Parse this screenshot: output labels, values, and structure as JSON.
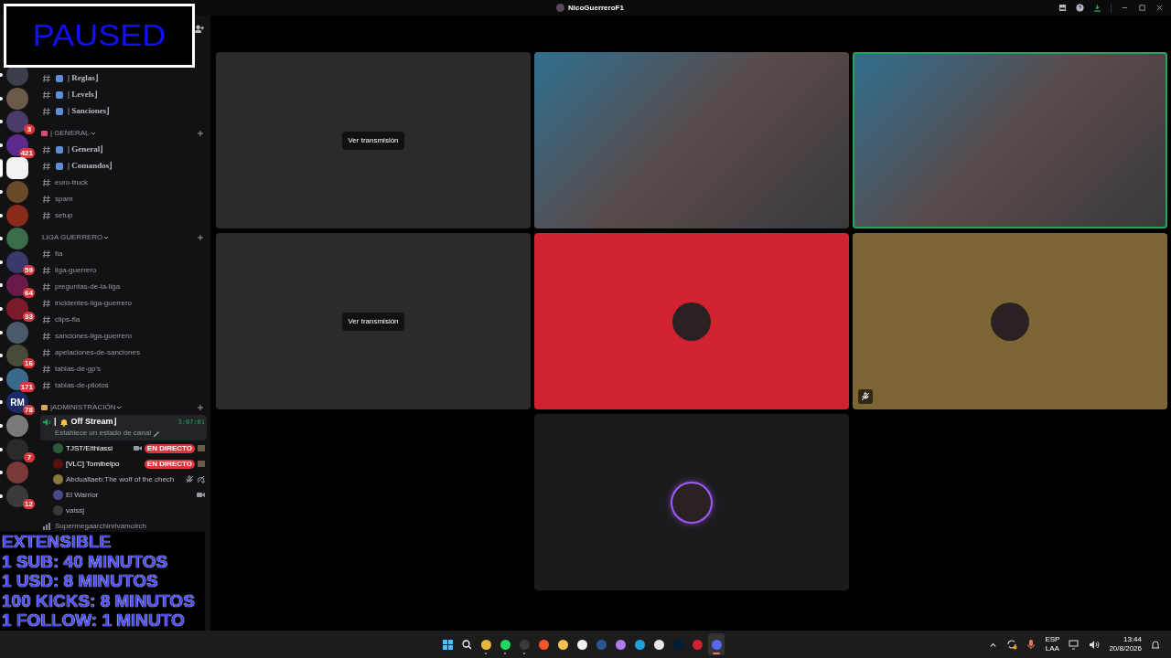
{
  "window": {
    "title": "NicoGuerreroF1"
  },
  "paused_overlay": {
    "text": "PAUSED"
  },
  "servers": [
    {
      "unread": true,
      "selected": false
    },
    {
      "unread": true,
      "selected": false
    },
    {
      "unread": true,
      "selected": false,
      "badge": "3"
    },
    {
      "unread": true,
      "selected": false,
      "badge": "421"
    },
    {
      "selected": true
    },
    {
      "unread": true,
      "selected": false
    },
    {
      "unread": true,
      "selected": false
    },
    {
      "unread": true,
      "selected": false
    },
    {
      "unread": true,
      "selected": false,
      "badge": "59"
    },
    {
      "unread": true,
      "selected": false,
      "badge": "64"
    },
    {
      "unread": true,
      "selected": false,
      "badge": "33"
    },
    {
      "unread": true,
      "selected": false
    },
    {
      "unread": true,
      "selected": false,
      "badge": "16"
    },
    {
      "unread": true,
      "selected": false,
      "badge": "171"
    },
    {
      "unread": true,
      "selected": false,
      "badge": "78",
      "label": "RM"
    },
    {
      "unread": true,
      "selected": false
    },
    {
      "unread": true,
      "selected": false,
      "badge": "7"
    },
    {
      "unread": true,
      "selected": false
    },
    {
      "unread": true,
      "selected": false,
      "badge": "12"
    }
  ],
  "categories": [
    {
      "channels": [
        {
          "kind": "decorated",
          "name": "| Reglas⌋"
        },
        {
          "kind": "decorated",
          "name": "| Levels⌋"
        },
        {
          "kind": "decorated",
          "name": "| Sanciones⌋"
        }
      ]
    },
    {
      "name": "| GENERAL",
      "channels": [
        {
          "kind": "decorated",
          "name": "| General⌋"
        },
        {
          "kind": "decorated",
          "name": "| Comandos⌋"
        },
        {
          "kind": "plain",
          "name": "euro-truck"
        },
        {
          "kind": "plain",
          "name": "spam"
        },
        {
          "kind": "plain",
          "name": "setup"
        }
      ]
    },
    {
      "name": "LIGA GUERRERO",
      "channels": [
        {
          "kind": "plain",
          "name": "fia"
        },
        {
          "kind": "plain",
          "name": "liga-guerrero"
        },
        {
          "kind": "plain",
          "name": "preguntas-de-la-liga"
        },
        {
          "kind": "plain",
          "name": "incidentes-liga-guerrero"
        },
        {
          "kind": "plain",
          "name": "clips-fia"
        },
        {
          "kind": "plain",
          "name": "sanciones-liga-guerrero"
        },
        {
          "kind": "plain",
          "name": "apelaciones-de-sanciones"
        },
        {
          "kind": "plain",
          "name": "tablas-de-gp's"
        },
        {
          "kind": "plain",
          "name": "tablas-de-pilotos"
        }
      ]
    },
    {
      "name": "|ADMINISTRACIÓN"
    }
  ],
  "voice_channel": {
    "prefix": "|",
    "name": "Off Stream⌋",
    "timer": "3:07:01",
    "status_hint": "Establece un estado de canal",
    "users": [
      {
        "name": "TJST/Elthiassi",
        "camera": true,
        "muted": false,
        "badge": "EN DIRECTO"
      },
      {
        "name": "[VLC] Tomibelpo",
        "camera": false,
        "muted": false,
        "badge": "EN DIRECTO"
      },
      {
        "name": "Abduallaeb:The wolf of the chech",
        "camera": false,
        "muted": true
      },
      {
        "name": "El Warrior",
        "camera": true,
        "muted": false
      },
      {
        "name": "vaissj",
        "camera": false,
        "muted": false
      }
    ]
  },
  "next_channel": {
    "name": "Supermegaarchinrivamoirch"
  },
  "stream_overlay": {
    "lines": [
      "EXTENSIBLE",
      "1 SUB: 40 MINUTOS",
      "1 USD: 8 MINUTOS",
      "100 KICKS: 8 MINUTOS",
      "1 FOLLOW: 1 MINUTO"
    ]
  },
  "tiles": [
    {
      "kind": "stream",
      "button": "Ver transmisión",
      "speaking": false
    },
    {
      "kind": "video",
      "speaking": false
    },
    {
      "kind": "video",
      "speaking": true
    },
    {
      "kind": "stream",
      "button": "Ver transmisión",
      "speaking": false
    },
    {
      "kind": "avatar",
      "color": "#d0222f",
      "speaking": false,
      "muted": false
    },
    {
      "kind": "avatar",
      "color": "#7c6434",
      "speaking": false,
      "muted": true
    },
    {
      "kind": "avatar",
      "color": "#1b1b1d",
      "speaking": true,
      "muted": false
    }
  ],
  "taskbar": {
    "apps": [
      {
        "kind": "start",
        "running": false,
        "active": false
      },
      {
        "kind": "search",
        "running": false,
        "active": false
      },
      {
        "kind": "app",
        "color": "#e8b73a",
        "running": true,
        "active": false
      },
      {
        "kind": "app",
        "color": "#1ed760",
        "running": true,
        "active": false
      },
      {
        "kind": "app",
        "color": "#3a3a3a",
        "running": true,
        "active": false
      },
      {
        "kind": "app",
        "color": "#fb542b",
        "running": false,
        "active": false
      },
      {
        "kind": "app",
        "color": "#f2c14e",
        "running": false,
        "active": false
      },
      {
        "kind": "app",
        "color": "#f0f0f0",
        "running": false,
        "active": false
      },
      {
        "kind": "app",
        "color": "#2b5797",
        "running": false,
        "active": false
      },
      {
        "kind": "app",
        "color": "#b07bf0",
        "running": false,
        "active": false
      },
      {
        "kind": "app",
        "color": "#1fa2d8",
        "running": false,
        "active": false
      },
      {
        "kind": "app",
        "color": "#e8e8e8",
        "running": false,
        "active": false
      },
      {
        "kind": "app",
        "color": "#001e36",
        "running": false,
        "active": false
      },
      {
        "kind": "app",
        "color": "#d0222f",
        "running": false,
        "active": false
      },
      {
        "kind": "app",
        "color": "#5865f2",
        "active": true
      }
    ],
    "language": "ESP",
    "layout": "LAA",
    "time": "13:44",
    "date": "20/8/2026"
  }
}
